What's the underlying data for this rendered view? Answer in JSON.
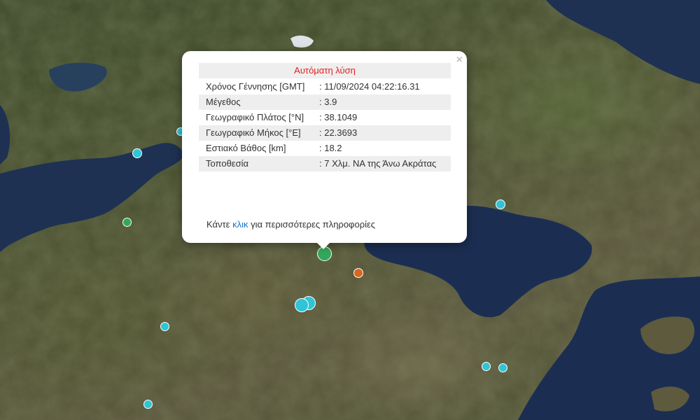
{
  "popup": {
    "title": "Αυτόματη λύση",
    "close_symbol": "×",
    "rows": [
      {
        "label": "Χρόνος Γέννησης [GMT]",
        "value": ": 11/09/2024 04:22:16.31"
      },
      {
        "label": "Μέγεθος",
        "value": ": 3.9"
      },
      {
        "label": "Γεωγραφικό Πλάτος [°N]",
        "value": ": 38.1049"
      },
      {
        "label": "Γεωγραφικό Μήκος [°E]",
        "value": ": 22.3693"
      },
      {
        "label": "Εστιακό Βάθος [km]",
        "value": ": 18.2"
      },
      {
        "label": "Τοποθεσία",
        "value": ": 7 Χλμ. ΝΑ της Άνω Ακράτας"
      }
    ],
    "more_prefix": "Κάντε ",
    "more_link": "κλικ",
    "more_suffix": " για περισσότερες πληροφορίες"
  },
  "colors": {
    "title_red": "#e02020",
    "link_blue": "#1a73c8",
    "marker_cyan": "#2fc4d6",
    "marker_green": "#33a85a",
    "marker_orange": "#d9661e",
    "sea": "#1c2f52"
  },
  "icons": [
    "close-icon",
    "earthquake-marker"
  ]
}
